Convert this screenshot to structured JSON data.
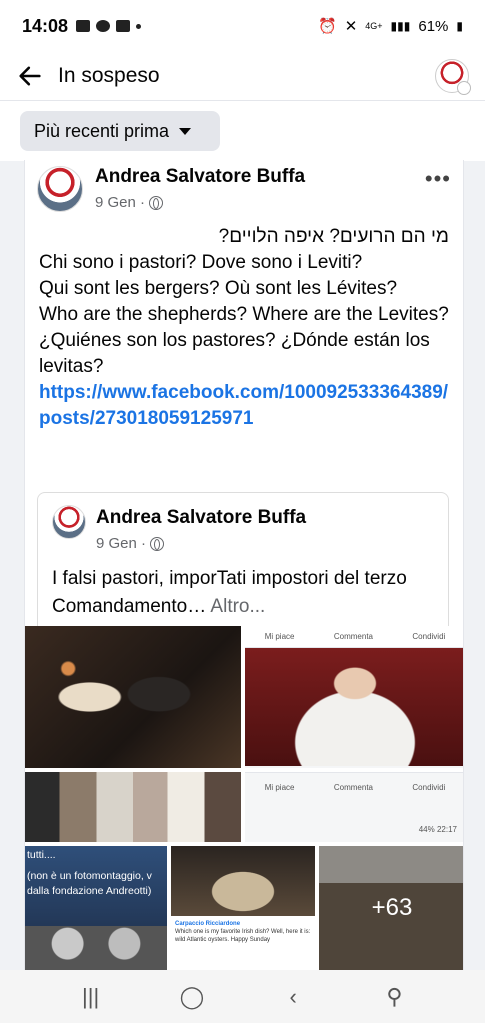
{
  "status_bar": {
    "time": "14:08",
    "network": "4G+",
    "battery": "61%"
  },
  "header": {
    "title": "In sospeso"
  },
  "filter": {
    "label": "Più recenti prima"
  },
  "post": {
    "author": "Andrea Salvatore Buffa",
    "date": "9 Gen · ",
    "text_lines": [
      "מי הם הרועים?  איפה הלויים?",
      "Chi sono i pastori? Dove sono i Leviti?",
      "Qui sont les bergers?  Où sont les Lévites?",
      "Who are the shepherds?  Where are the Levites?",
      "¿Quiénes son los pastores?  ¿Dónde están los levitas?"
    ],
    "link": "https://www.facebook.com/100092533364389/posts/273018059125971"
  },
  "shared": {
    "author": "Andrea Salvatore Buffa",
    "date": "9 Gen · ",
    "text": "I falsi pastori, imporTati impostori del terzo Comandamento… ",
    "more": "Altro..."
  },
  "photos": {
    "bar_like": "Mi piace",
    "bar_comment": "Commenta",
    "bar_share": "Condividi",
    "status_mini": "44% 22:17",
    "caption_lines": [
      "tutti....",
      "(non è un fotomontaggio, v",
      "dalla fondazione Andreotti)"
    ],
    "comment_author": "Carpaccio Ricciardone",
    "comment_text": "Which one is my favorite Irish dish? Well, here it is: wild Atlantic oysters. Happy Sunday",
    "more_count": "+63"
  }
}
